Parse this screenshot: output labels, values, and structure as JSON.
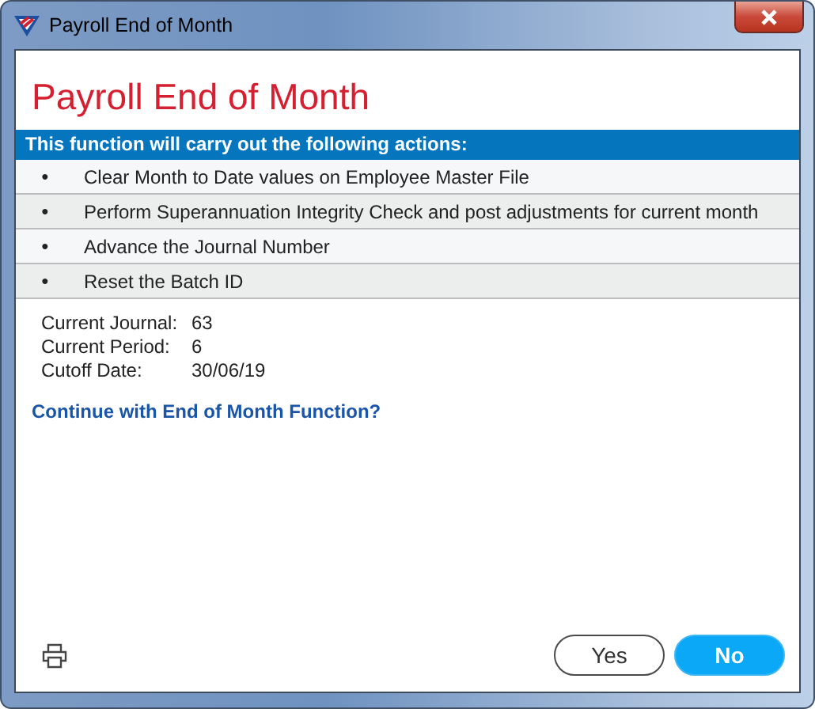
{
  "window": {
    "title": "Payroll End of Month"
  },
  "heading": "Payroll End of Month",
  "actions_header": "This function will carry out the following actions:",
  "actions": [
    {
      "bullet": "●",
      "text": "Clear Month to Date values on Employee Master File"
    },
    {
      "bullet": "●",
      "text": "Perform Superannuation Integrity Check and post adjustments for current month"
    },
    {
      "bullet": "●",
      "text": "Advance the Journal Number"
    },
    {
      "bullet": "●",
      "text": "Reset the Batch ID"
    }
  ],
  "info": [
    {
      "label": "Current Journal:",
      "value": "63"
    },
    {
      "label": "Current Period:",
      "value": "6"
    },
    {
      "label": "Cutoff Date:",
      "value": "30/06/19"
    }
  ],
  "prompt": "Continue with End of Month Function?",
  "buttons": [
    {
      "label": "Yes",
      "default": false
    },
    {
      "label": "No",
      "default": true
    }
  ]
}
